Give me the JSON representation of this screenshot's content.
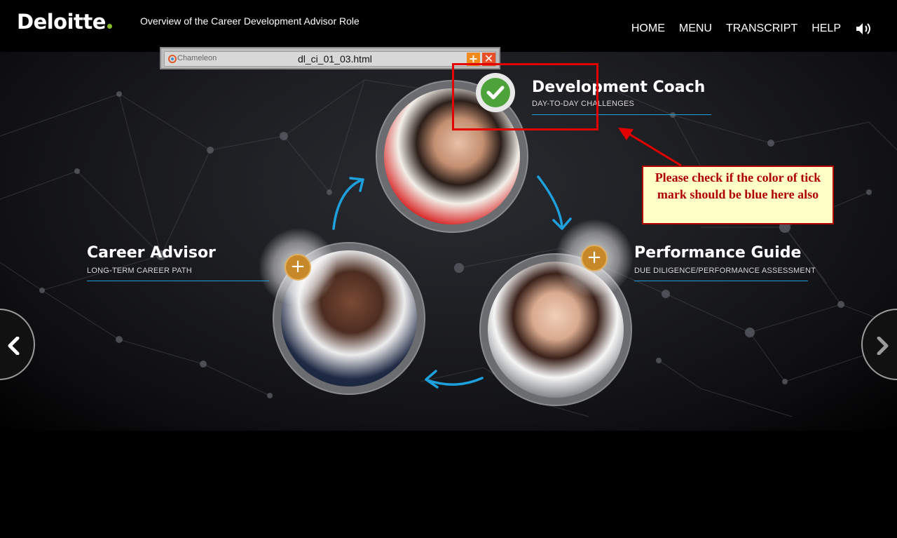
{
  "header": {
    "logo": "Deloitte",
    "course_title": "Overview of the Career Development Advisor Role",
    "nav": [
      "HOME",
      "MENU",
      "TRANSCRIPT",
      "HELP"
    ],
    "sound_icon": "speaker-icon"
  },
  "popup": {
    "brand": "Chameleon",
    "filename": "dl_ci_01_03.html",
    "add_label": "+",
    "close_label": "✕"
  },
  "roles": {
    "coach": {
      "title": "Development Coach",
      "subtitle": "DAY-TO-DAY CHALLENGES",
      "status": "completed",
      "badge_icon": "check-icon"
    },
    "advisor": {
      "title": "Career Advisor",
      "subtitle": "LONG-TERM CAREER PATH",
      "badge_label": "+"
    },
    "guide": {
      "title": "Performance Guide",
      "subtitle": "DUE DILIGENCE/PERFORMANCE ASSESSMENT",
      "badge_label": "+"
    }
  },
  "navigation": {
    "prev_icon": "chevron-left-icon",
    "next_icon": "chevron-right-icon"
  },
  "review": {
    "note": "Please check if the color of tick mark should be blue here also"
  },
  "colors": {
    "accent_blue": "#1ea0dc",
    "plus_gold": "#c7882a",
    "check_green": "#4ea23a",
    "logo_dot": "#86bc25",
    "review_red": "#e30000",
    "note_bg": "#ffffc8"
  }
}
